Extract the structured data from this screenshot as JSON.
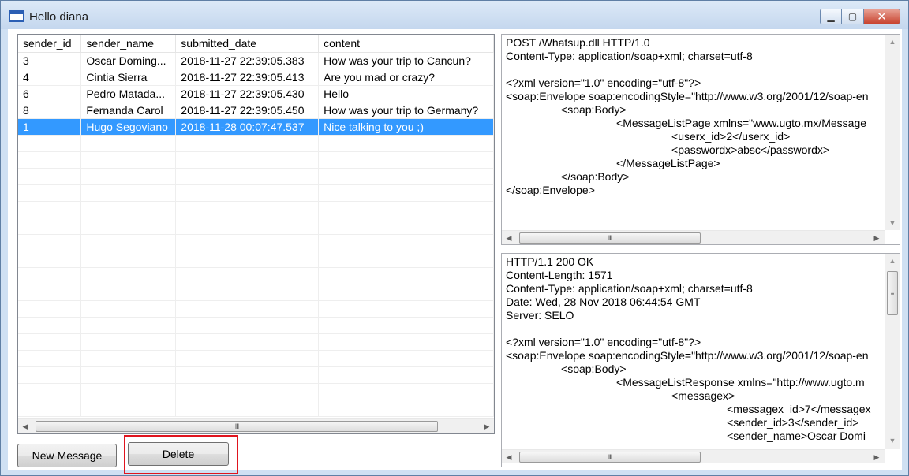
{
  "window": {
    "title": "Hello diana",
    "minimize_glyph": "▁",
    "maximize_glyph": "▢",
    "close_glyph": "✕"
  },
  "grid": {
    "columns": [
      "sender_id",
      "sender_name",
      "submitted_date",
      "content"
    ],
    "rows": [
      {
        "sender_id": "3",
        "sender_name": "Oscar Doming...",
        "submitted_date": "2018-11-27 22:39:05.383",
        "content": "How was your trip to Cancun?"
      },
      {
        "sender_id": "4",
        "sender_name": "Cintia Sierra",
        "submitted_date": "2018-11-27 22:39:05.413",
        "content": "Are you mad or crazy?"
      },
      {
        "sender_id": "6",
        "sender_name": "Pedro Matada...",
        "submitted_date": "2018-11-27 22:39:05.430",
        "content": "Hello"
      },
      {
        "sender_id": "8",
        "sender_name": "Fernanda Carol",
        "submitted_date": "2018-11-27 22:39:05.450",
        "content": "How was your trip to Germany?"
      },
      {
        "sender_id": "1",
        "sender_name": "Hugo Segoviano",
        "submitted_date": "2018-11-28 00:07:47.537",
        "content": "Nice talking to you ;)"
      }
    ],
    "selected_row": 4,
    "empty_rows": 17
  },
  "request_pane": {
    "text": "POST /Whatsup.dll HTTP/1.0\nContent-Type: application/soap+xml; charset=utf-8\n\n<?xml version=\"1.0\" encoding=\"utf-8\"?>\n<soap:Envelope soap:encodingStyle=\"http://www.w3.org/2001/12/soap-en\n\t\t<soap:Body>\n\t\t\t\t<MessageListPage xmlns=\"www.ugto.mx/Message\n\t\t\t\t\t\t<userx_id>2</userx_id>\n\t\t\t\t\t\t<passwordx>absc</passwordx>\n\t\t\t\t</MessageListPage>\n\t\t</soap:Body>\n</soap:Envelope>"
  },
  "response_pane": {
    "text": "HTTP/1.1 200 OK\nContent-Length: 1571\nContent-Type: application/soap+xml; charset=utf-8\nDate: Wed, 28 Nov 2018 06:44:54 GMT\nServer: SELO\n\n<?xml version=\"1.0\" encoding=\"utf-8\"?>\n<soap:Envelope soap:encodingStyle=\"http://www.w3.org/2001/12/soap-en\n\t\t<soap:Body>\n\t\t\t\t<MessageListResponse xmlns=\"http://www.ugto.m\n\t\t\t\t\t\t<messagex>\n\t\t\t\t\t\t\t\t<messagex_id>7</messagex\n\t\t\t\t\t\t\t\t<sender_id>3</sender_id>\n\t\t\t\t\t\t\t\t<sender_name>Oscar Domi"
  },
  "buttons": {
    "new_message": "New Message",
    "delete": "Delete"
  },
  "scroll_glyphs": {
    "left": "◀",
    "right": "▶",
    "up": "▲",
    "down": "▼",
    "grip_h": "III",
    "grip_v": "≡"
  },
  "colors": {
    "selection": "#3399ff",
    "highlight": "#e0141e",
    "frame": "#cfe0f3"
  }
}
